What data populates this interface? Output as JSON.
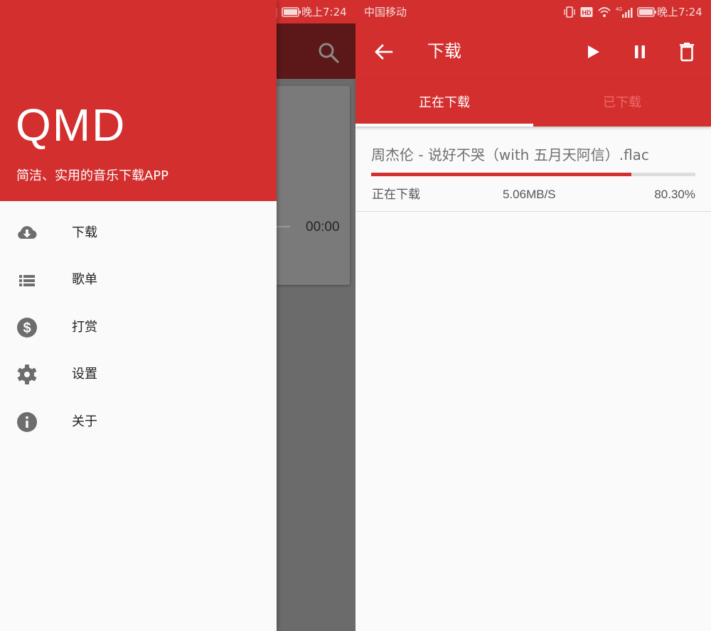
{
  "status_bar": {
    "carrier": "中国移动",
    "time": "晚上7:24",
    "icons": [
      "vibrate-icon",
      "hd-icon",
      "wifi-icon",
      "signal-4g-icon",
      "battery-icon"
    ]
  },
  "left_screen": {
    "background": {
      "time_text": "00:00",
      "icon": "search-icon"
    },
    "drawer": {
      "title": "QMD",
      "subtitle": "简洁、实用的音乐下载APP",
      "items": [
        {
          "label": "下载",
          "icon": "cloud-download-icon"
        },
        {
          "label": "歌单",
          "icon": "list-icon"
        },
        {
          "label": "打赏",
          "icon": "dollar-icon"
        },
        {
          "label": "设置",
          "icon": "gear-icon"
        },
        {
          "label": "关于",
          "icon": "info-icon"
        }
      ]
    }
  },
  "right_screen": {
    "app_bar": {
      "title": "下载",
      "actions": [
        "play-icon",
        "pause-icon",
        "delete-icon"
      ]
    },
    "tabs": [
      {
        "label": "正在下载",
        "active": true
      },
      {
        "label": "已下载",
        "active": false
      }
    ],
    "downloads": [
      {
        "file_name": "周杰伦 - 说好不哭（with 五月天阿信）.flac",
        "status": "正在下载",
        "speed": "5.06MB/S",
        "percent": "80.30%",
        "progress": 0.803
      }
    ]
  },
  "colors": {
    "primary": "#d32f2f",
    "tab_inactive": "#ef6a6a",
    "icon_gray": "#6d6d6d"
  }
}
